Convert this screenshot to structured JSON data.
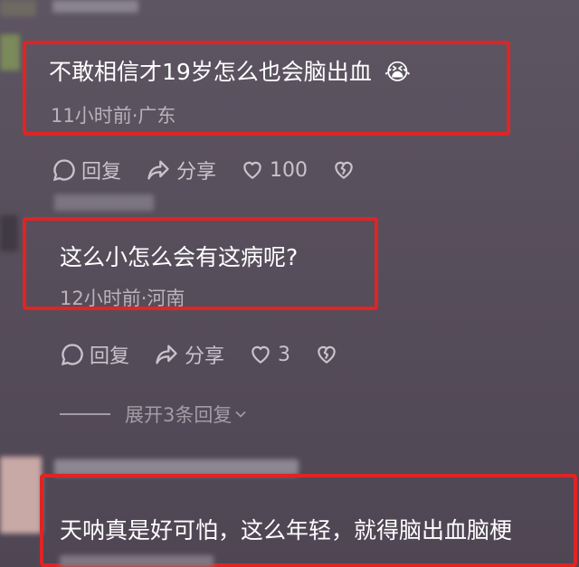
{
  "comments": [
    {
      "text": "不敢相信才19岁怎么也会脑出血",
      "emoji": "😭",
      "meta": "11小时前·广东",
      "reply_label": "回复",
      "share_label": "分享",
      "likes": "100"
    },
    {
      "text": "这么小怎么会有这病呢?",
      "meta": "12小时前·河南",
      "reply_label": "回复",
      "share_label": "分享",
      "likes": "3",
      "expand_label": "展开3条回复"
    },
    {
      "text": "天呐真是好可怕，这么年轻，就得脑出血脑梗"
    }
  ],
  "colors": {
    "highlight": "#e02424",
    "background": "#574e5c",
    "meta_text": "#b9b2bb"
  },
  "icons": [
    "comment-bubble-icon",
    "share-arrow-icon",
    "heart-icon",
    "broken-heart-icon",
    "chevron-down-icon"
  ]
}
